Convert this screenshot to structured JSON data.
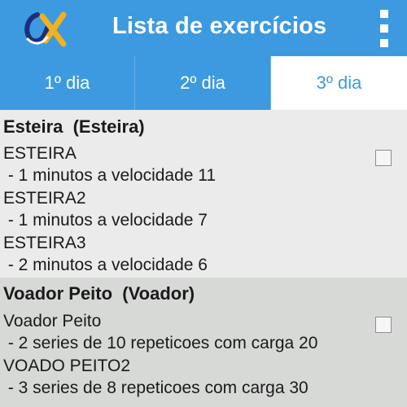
{
  "appbar": {
    "title": "Lista de exercícios",
    "logo_icon": "app-logo-alpha",
    "menu_icon": "overflow-menu-icon",
    "color": "#3d9ae0"
  },
  "tabs": [
    {
      "label": "1º dia",
      "selected": false
    },
    {
      "label": "2º dia",
      "selected": false
    },
    {
      "label": "3º dia",
      "selected": true
    }
  ],
  "sections": [
    {
      "title": "Esteira  (Esteira)",
      "exercises": [
        {
          "name": "ESTEIRA",
          "detail": " - 1 minutos a velocidade 11"
        },
        {
          "name": "ESTEIRA2",
          "detail": " - 1 minutos a velocidade 7"
        },
        {
          "name": "ESTEIRA3",
          "detail": " - 2 minutos a velocidade 6"
        }
      ],
      "checked": false
    },
    {
      "title": "Voador Peito  (Voador)",
      "exercises": [
        {
          "name": "Voador Peito",
          "detail": " - 2 series de 10 repeticoes com carga 20"
        },
        {
          "name": "VOADO PEITO2",
          "detail": " - 3 series de 8 repeticoes com carga 30"
        }
      ],
      "checked": false
    }
  ]
}
